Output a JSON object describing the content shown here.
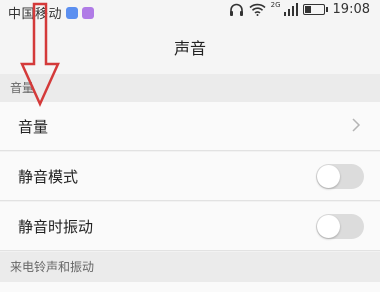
{
  "status_bar": {
    "carrier": "中国移动",
    "network_type": "2G",
    "time": "19:08",
    "battery_level": 0.35,
    "icons": [
      "app-badge-blue",
      "app-badge-purple",
      "headphones-icon",
      "wifi-icon",
      "signal-icon",
      "battery-icon"
    ]
  },
  "header": {
    "title": "声音"
  },
  "sections": [
    {
      "header": "音量",
      "rows": [
        {
          "label": "音量",
          "control": "chevron"
        },
        {
          "label": "静音模式",
          "control": "toggle",
          "on": false
        },
        {
          "label": "静音时振动",
          "control": "toggle",
          "on": false
        }
      ]
    },
    {
      "header": "来电铃声和振动",
      "rows": []
    }
  ],
  "colors": {
    "annotation_arrow": "#d43a3a",
    "toggle_off": "#dcdcdc"
  }
}
